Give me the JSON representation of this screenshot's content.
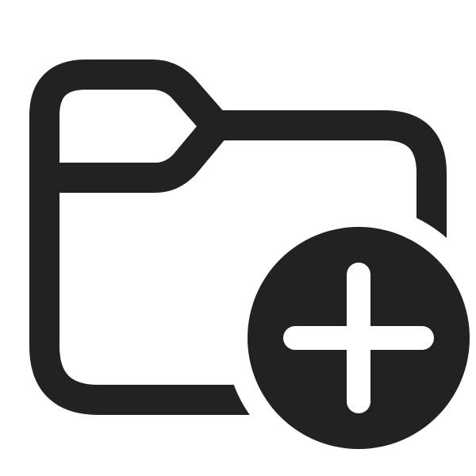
{
  "icon": {
    "name": "folder-add-icon",
    "stroke_color": "#222222",
    "badge_color": "#222222",
    "plus_color": "#ffffff",
    "background": "#ffffff"
  }
}
